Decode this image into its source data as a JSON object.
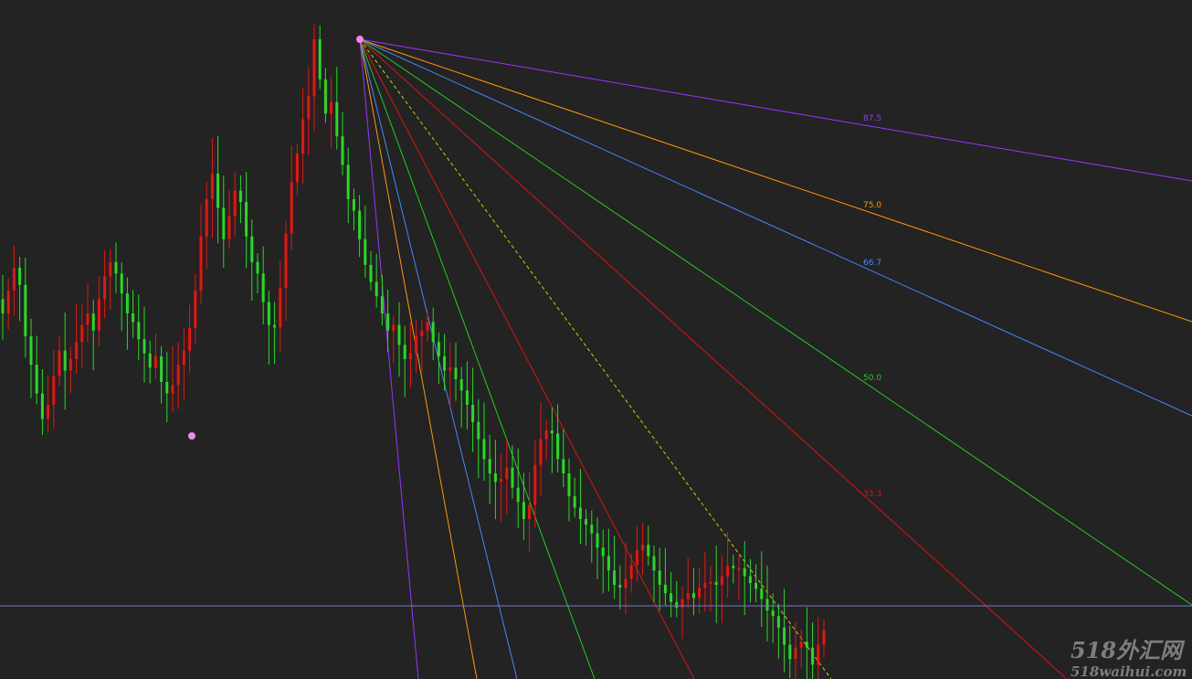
{
  "chart_data": {
    "type": "candlestick",
    "title": "",
    "colors": {
      "background": "#232323",
      "bull": "#22dd22",
      "bear": "#ee1111",
      "hline": "#7777cc",
      "anchor": "#ee88ee"
    },
    "y_range": [
      0,
      1000
    ],
    "fan": {
      "levels": [
        {
          "label": "87.5",
          "color": "#9933ff"
        },
        {
          "label": "75.0",
          "color": "#ff9900"
        },
        {
          "label": "66.7",
          "color": "#4488ff"
        },
        {
          "label": "50.0",
          "color": "#22cc22"
        },
        {
          "label": "33.3",
          "color": "#dd1111"
        }
      ],
      "center_color": "#cccc00"
    },
    "watermark": {
      "main": "518外汇网",
      "sub": "518waihui.com"
    }
  }
}
